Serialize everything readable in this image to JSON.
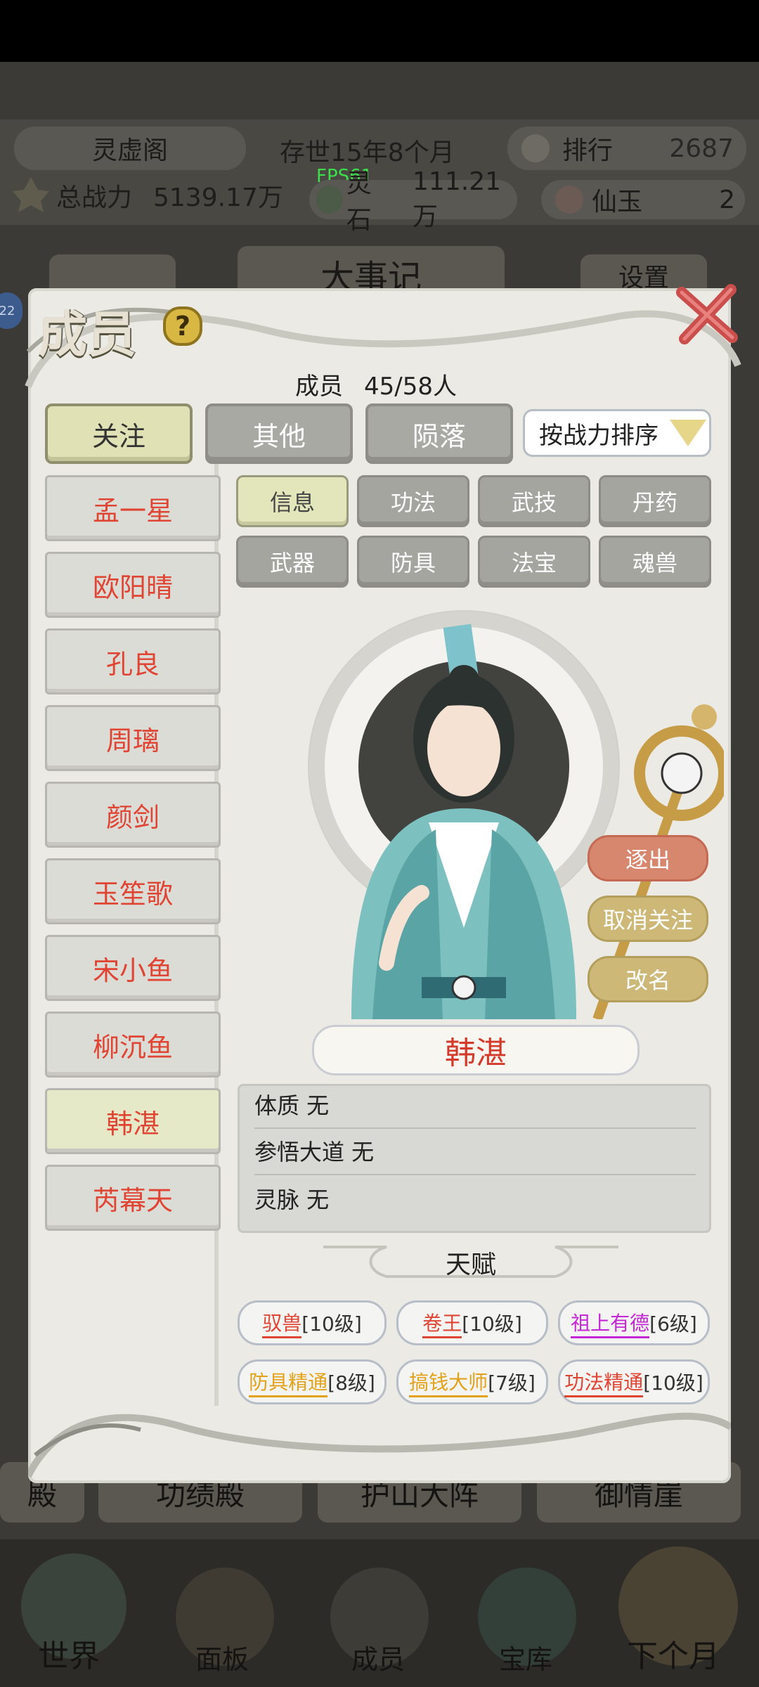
{
  "hud": {
    "sect_name": "灵虚阁",
    "age": "存世15年8个月",
    "rank_label": "排行",
    "rank_value": "2687",
    "power_label": "总战力",
    "power_value": "5139.17万",
    "fps": "FPS61",
    "stone_label": "灵石",
    "stone_value": "111.21万",
    "jade_label": "仙玉",
    "jade_value": "2",
    "events_label": "大事记",
    "settings_label": "设置",
    "level_badge": "22"
  },
  "panel": {
    "title": "成员",
    "help": "?",
    "count_label": "成员",
    "count_value": "45/58人",
    "filter_tabs": [
      "关注",
      "其他",
      "陨落"
    ],
    "sort_label": "按战力排序"
  },
  "members": [
    "孟一星",
    "欧阳晴",
    "孔良",
    "周璃",
    "颜剑",
    "玉笙歌",
    "宋小鱼",
    "柳沉鱼",
    "韩湛",
    "芮幕天"
  ],
  "selected_member": "韩湛",
  "detail_tabs": [
    "信息",
    "功法",
    "武技",
    "丹药",
    "武器",
    "防具",
    "法宝",
    "魂兽"
  ],
  "actions": {
    "expel": "逐出",
    "unfollow": "取消关注",
    "rename": "改名"
  },
  "info": {
    "name": "韩湛",
    "rows": [
      "体质 无",
      "参悟大道 无",
      "灵脉 无"
    ]
  },
  "talents": {
    "title": "天赋",
    "items": [
      {
        "name": "驭兽",
        "level": "[10级]",
        "color": "#e04534"
      },
      {
        "name": "卷王",
        "level": "[10级]",
        "color": "#e04534"
      },
      {
        "name": "祖上有德",
        "level": "[6级]",
        "color": "#c527d6"
      },
      {
        "name": "防具精通",
        "level": "[8级]",
        "color": "#e3a21a"
      },
      {
        "name": "搞钱大师",
        "level": "[7级]",
        "color": "#e3a21a"
      },
      {
        "name": "功法精通",
        "level": "[10级]",
        "color": "#e04534"
      }
    ]
  },
  "background_buttons": [
    "殿",
    "功绩殿",
    "护山大阵",
    "御情崖"
  ],
  "bottom_nav": [
    "世界",
    "面板",
    "成员",
    "宝库",
    "下个月"
  ]
}
